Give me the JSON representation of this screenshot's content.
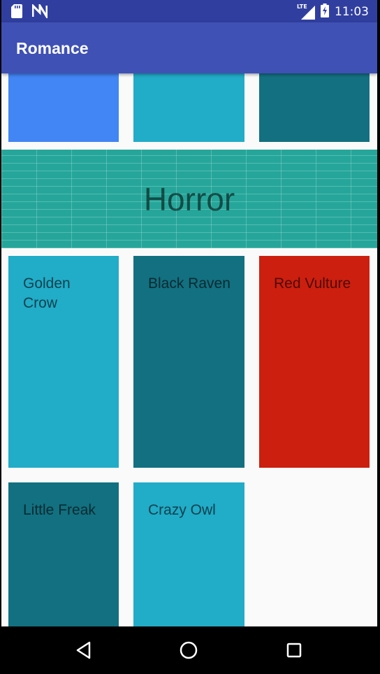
{
  "status_bar": {
    "time": "11:03",
    "network": "LTE",
    "icons": [
      "sd-card-icon",
      "n-logo-icon",
      "signal-icon",
      "battery-charging-icon"
    ]
  },
  "app_bar": {
    "title": "Romance"
  },
  "colors": {
    "blue": "#4285f4",
    "cyan": "#21acc8",
    "teal_dark": "#127080",
    "red": "#cc1f0f",
    "banner": "#26a69a",
    "app_bar": "#3f51b5",
    "status_bar": "#303f9f"
  },
  "top_tiles": [
    {
      "label": "",
      "color": "blue"
    },
    {
      "label": "",
      "color": "cyan"
    },
    {
      "label": "",
      "color": "teal_dark"
    }
  ],
  "section": {
    "title": "Horror"
  },
  "tiles": [
    {
      "label": "Golden Crow",
      "color": "cyan"
    },
    {
      "label": "Black Raven",
      "color": "teal_dark"
    },
    {
      "label": "Red Vulture",
      "color": "red"
    },
    {
      "label": "Little Freak",
      "color": "teal_dark"
    },
    {
      "label": "Crazy Owl",
      "color": "cyan"
    }
  ],
  "nav_bar": {
    "buttons": [
      "back-icon",
      "home-icon",
      "recents-icon"
    ]
  }
}
